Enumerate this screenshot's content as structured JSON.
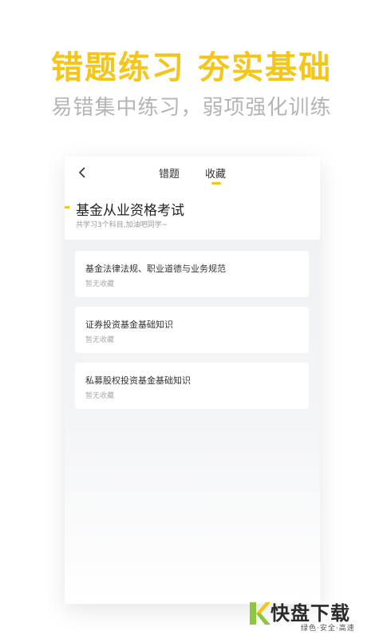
{
  "banner": {
    "headline": "错题练习 夯实基础",
    "subline": "易错集中练习，弱项强化训练"
  },
  "topbar": {
    "back_icon": "chevron-left-icon",
    "tabs": [
      {
        "label": "错题",
        "active": false
      },
      {
        "label": "收藏",
        "active": true
      }
    ]
  },
  "exam": {
    "title": "基金从业资格考试",
    "subtitle": "共学习3个科目,加油吧同学~"
  },
  "subjects": [
    {
      "title": "基金法律法规、职业道德与业务规范",
      "status": "暂无收藏"
    },
    {
      "title": "证券投资基金基础知识",
      "status": "暂无收藏"
    },
    {
      "title": "私募股权投资基金基础知识",
      "status": "暂无收藏"
    }
  ],
  "brand": {
    "name": "快盘下载",
    "tagline": "绿色·安全·高速",
    "logo_icon": "k-logo-icon"
  },
  "colors": {
    "accent": "#f5c518",
    "subtitle_gray": "#b5b5b5",
    "logo_green": "#8dc63f"
  }
}
